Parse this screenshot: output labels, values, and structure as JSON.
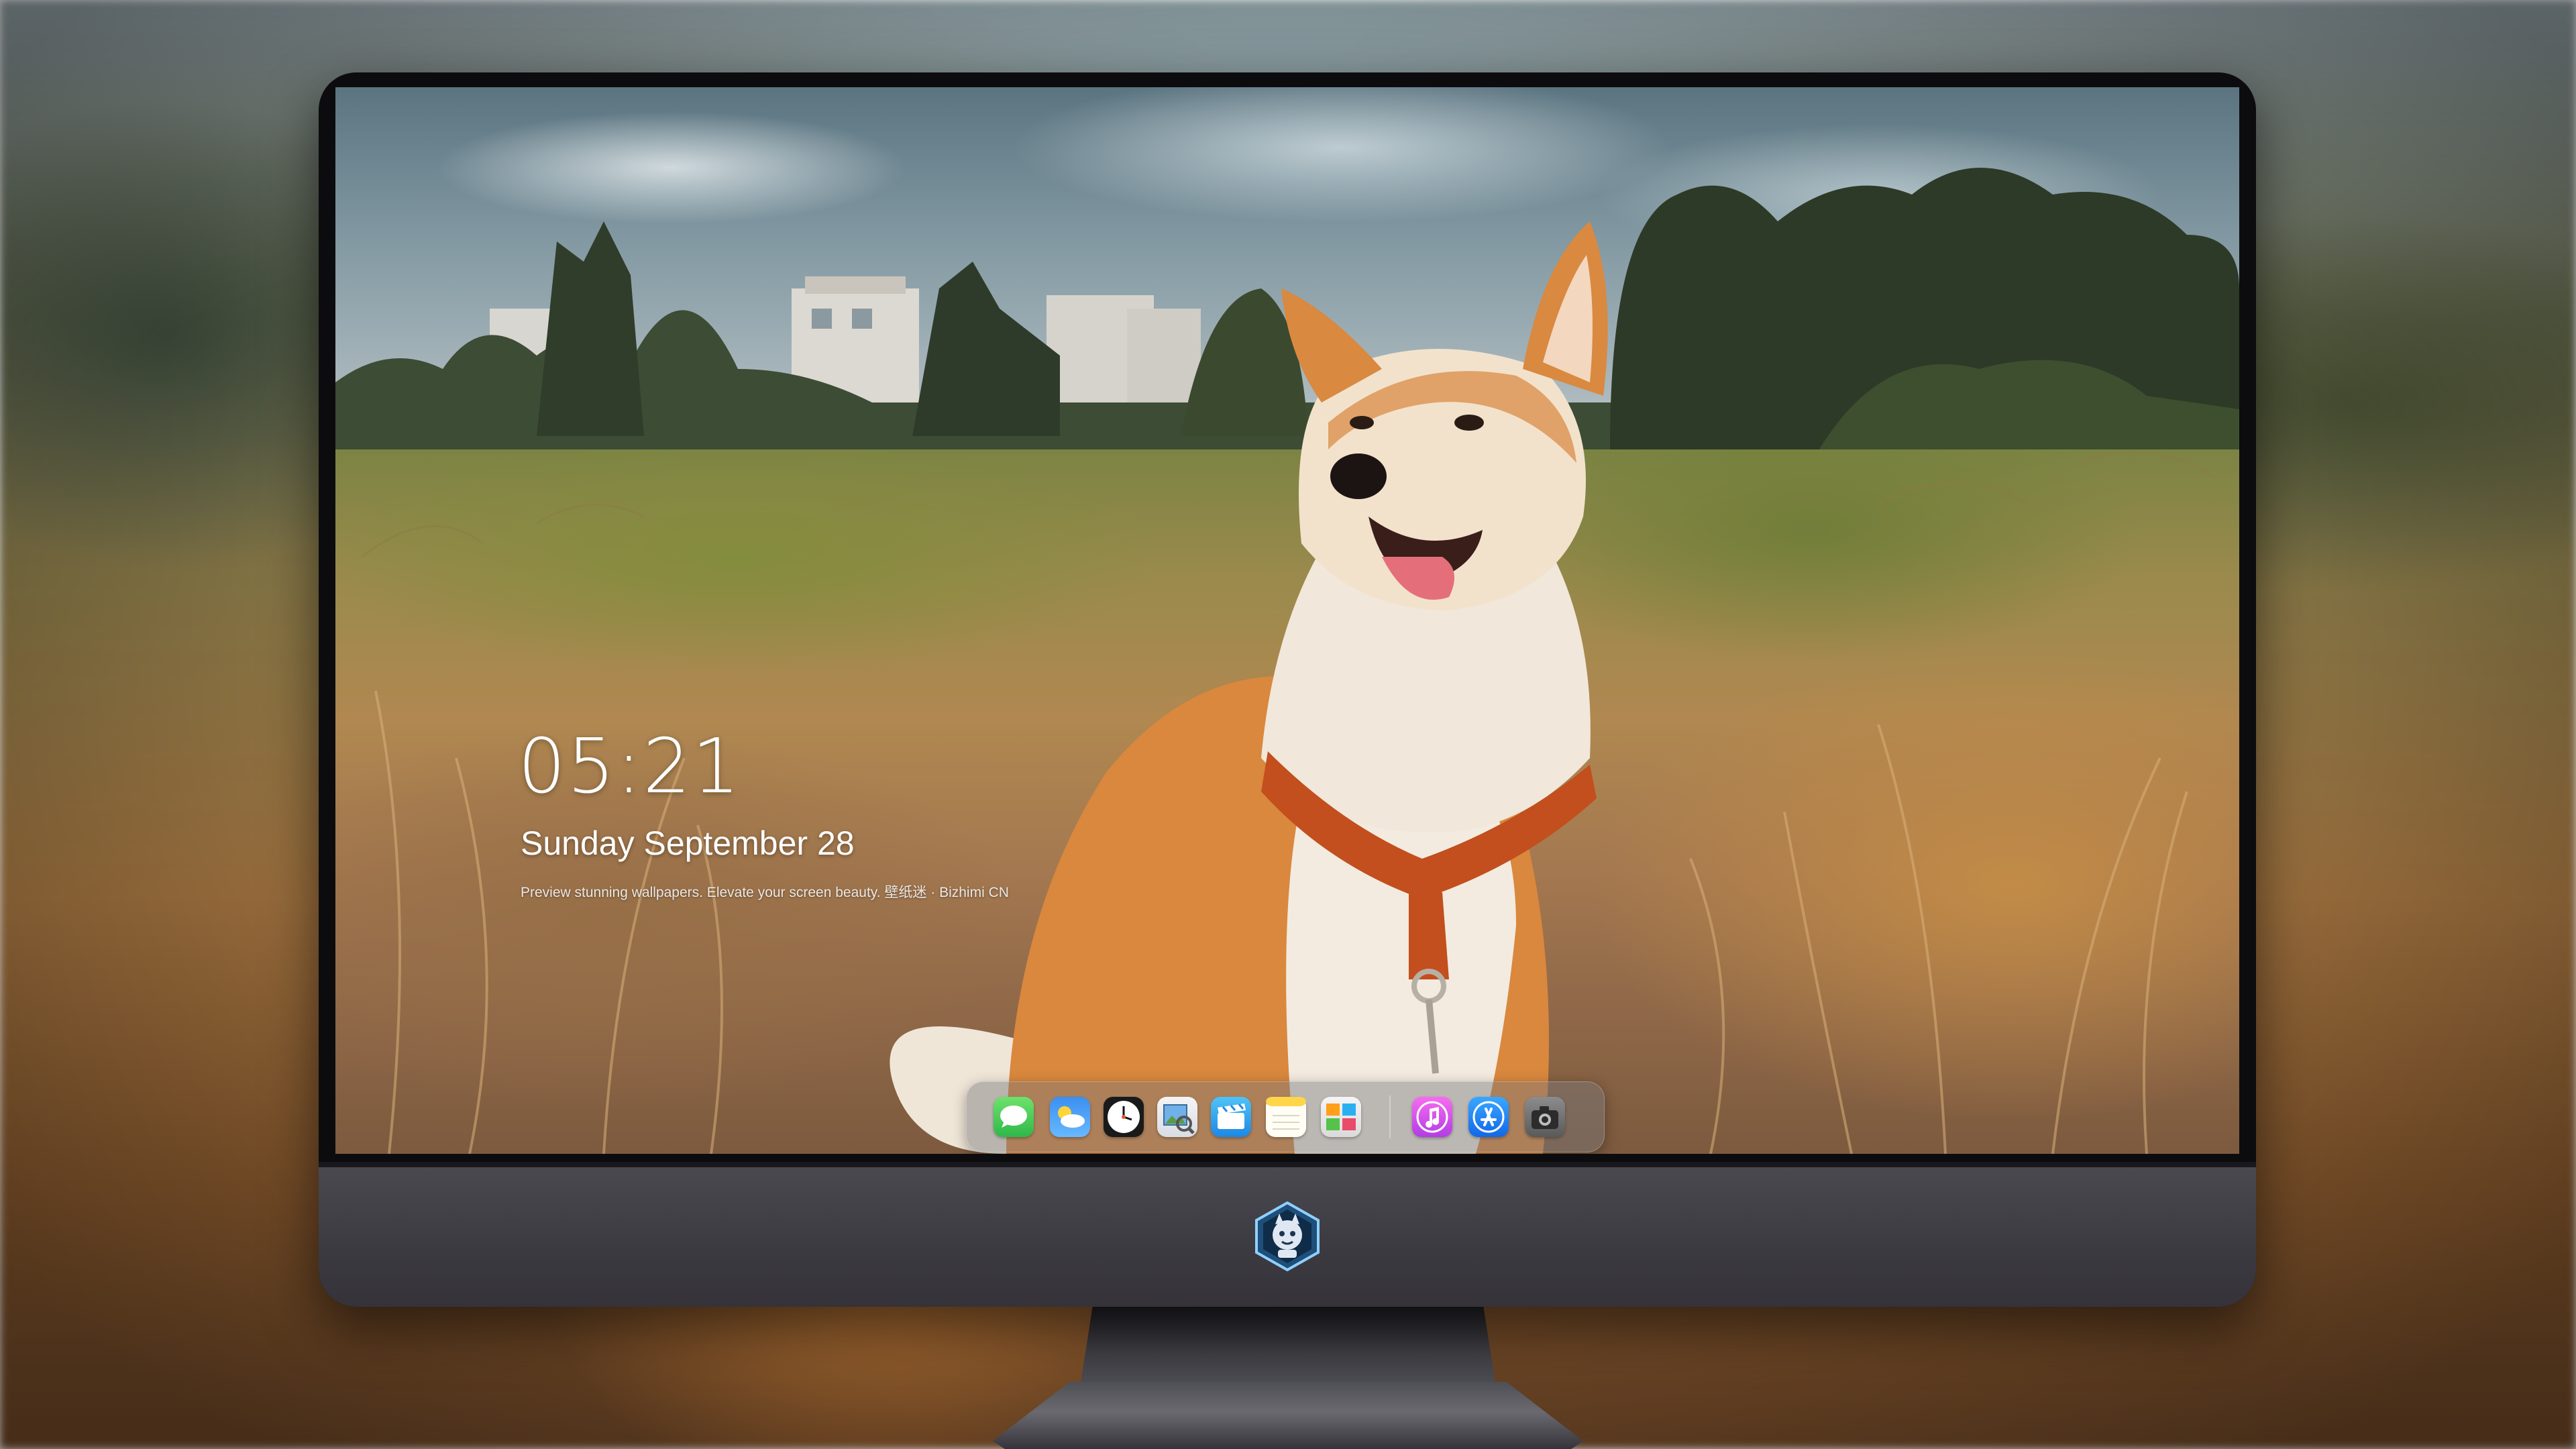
{
  "lock_screen": {
    "time": "05:21",
    "date": "Sunday September  28",
    "caption": "Preview stunning wallpapers. Elevate your screen beauty. 壁纸迷 · Bizhimi CN"
  },
  "dock": {
    "apps": [
      {
        "name": "Messages",
        "icon": "messages-icon"
      },
      {
        "name": "Weather",
        "icon": "weather-icon"
      },
      {
        "name": "Clock",
        "icon": "clock-icon"
      },
      {
        "name": "Preview",
        "icon": "preview-icon"
      },
      {
        "name": "Clips",
        "icon": "clips-icon"
      },
      {
        "name": "Notes",
        "icon": "notes-icon"
      },
      {
        "name": "Photo Booth",
        "icon": "photo-booth-icon"
      },
      {
        "name": "iTunes",
        "icon": "itunes-icon"
      },
      {
        "name": "App Store",
        "icon": "app-store-icon"
      },
      {
        "name": "Screenshot",
        "icon": "camera-icon"
      }
    ]
  },
  "monitor": {
    "brand_logo": "brand-logo"
  },
  "colors": {
    "bezel": "#0c0c0e",
    "chin": "#3c3a41",
    "dock_bg": "rgba(120,120,125,0.45)"
  }
}
